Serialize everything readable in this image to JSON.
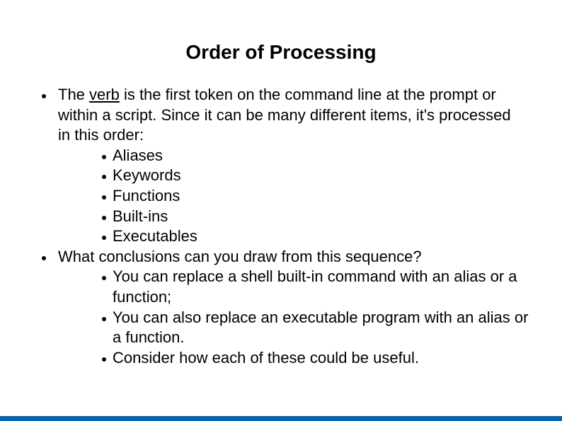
{
  "slide": {
    "title": "Order of Processing",
    "bullets": [
      {
        "pre": "The ",
        "underlined": "verb",
        "post": " is the first token on the command line at the prompt or within a script. Since it can be many different items, it's processed in this order:",
        "sub": [
          "Aliases",
          "Keywords",
          "Functions",
          "Built-ins",
          "Executables"
        ]
      },
      {
        "text": "What conclusions can you draw from this sequence?",
        "sub": [
          "You can replace a shell built-in command with an alias or a function;",
          "You can also replace an executable program with an alias or a function.",
          "Consider how each of these could be useful."
        ]
      }
    ],
    "colors": {
      "footer_bar": "#0563aa",
      "text": "#000000",
      "background": "#ffffff"
    }
  }
}
